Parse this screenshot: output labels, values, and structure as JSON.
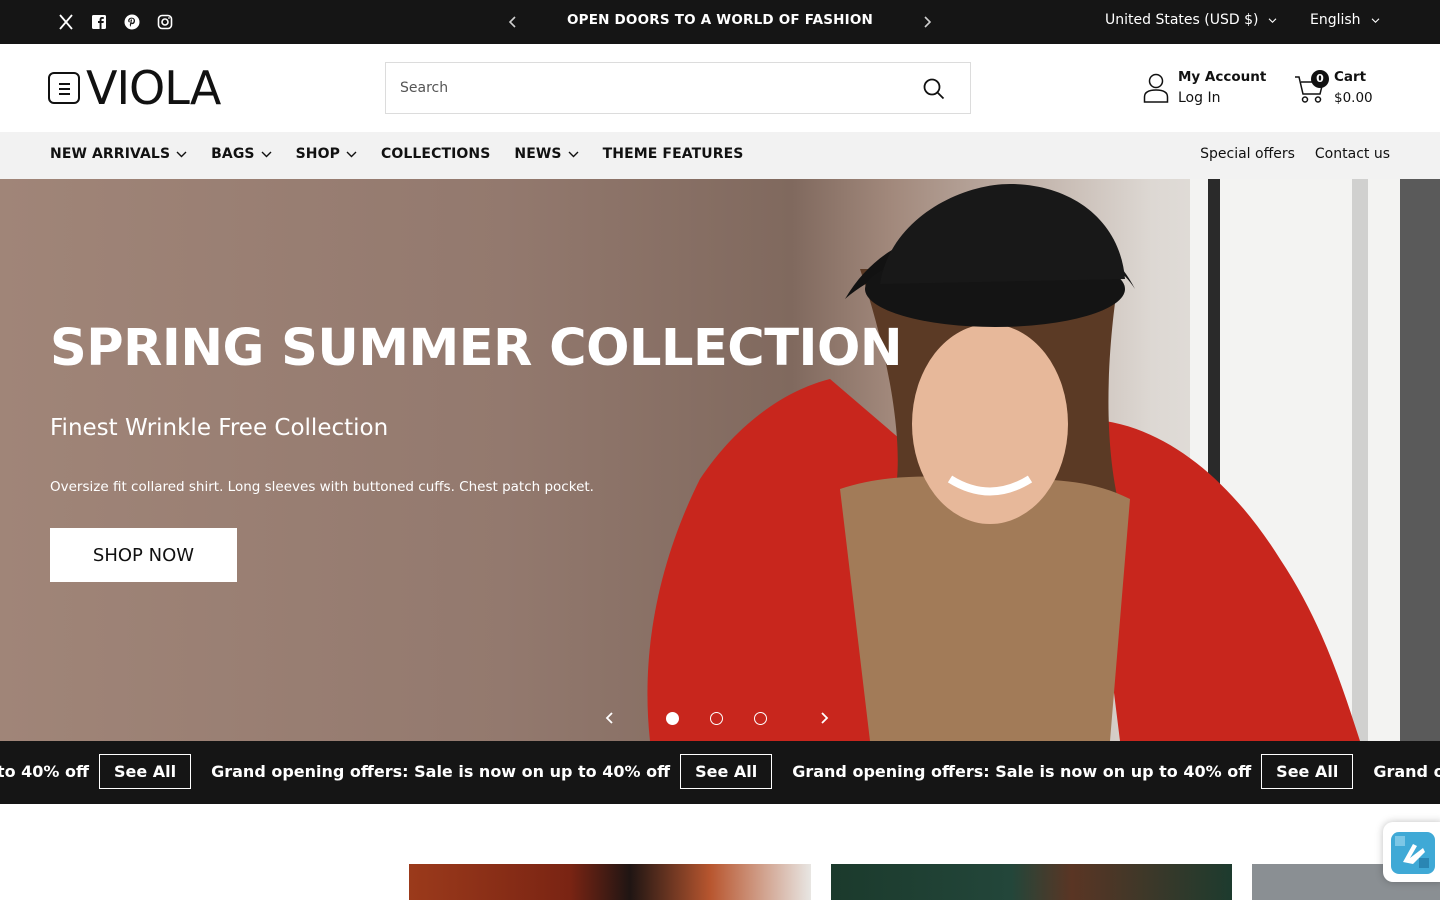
{
  "topbar": {
    "social": [
      "x-icon",
      "facebook-icon",
      "pinterest-icon",
      "instagram-icon"
    ],
    "announcement": "OPEN DOORS TO A WORLD OF FASHION",
    "country": "United States (USD $)",
    "language": "English"
  },
  "header": {
    "logo": "VIOLA",
    "search_placeholder": "Search",
    "account_line1": "My Account",
    "account_line2": "Log In",
    "cart_count": "0",
    "cart_label": "Cart",
    "cart_total": "$0.00"
  },
  "nav": {
    "items": [
      {
        "label": "NEW ARRIVALS",
        "dropdown": true
      },
      {
        "label": "BAGS",
        "dropdown": true
      },
      {
        "label": "SHOP",
        "dropdown": true
      },
      {
        "label": "COLLECTIONS",
        "dropdown": false
      },
      {
        "label": "NEWS",
        "dropdown": true
      },
      {
        "label": "THEME FEATURES",
        "dropdown": false
      }
    ],
    "right": [
      "Special offers",
      "Contact us"
    ]
  },
  "hero": {
    "title": "SPRING SUMMER COLLECTION",
    "subtitle": "Finest Wrinkle Free Collection",
    "description": "Oversize fit collared shirt. Long sleeves with buttoned cuffs. Chest patch pocket.",
    "cta": "SHOP NOW",
    "slides": 3,
    "active_slide": 1
  },
  "marquee": {
    "text": "Grand opening offers: Sale is now on up to 40% off",
    "button": "See All"
  },
  "colors": {
    "dark": "#151515",
    "accent_red": "#c8261d",
    "white": "#ffffff"
  }
}
